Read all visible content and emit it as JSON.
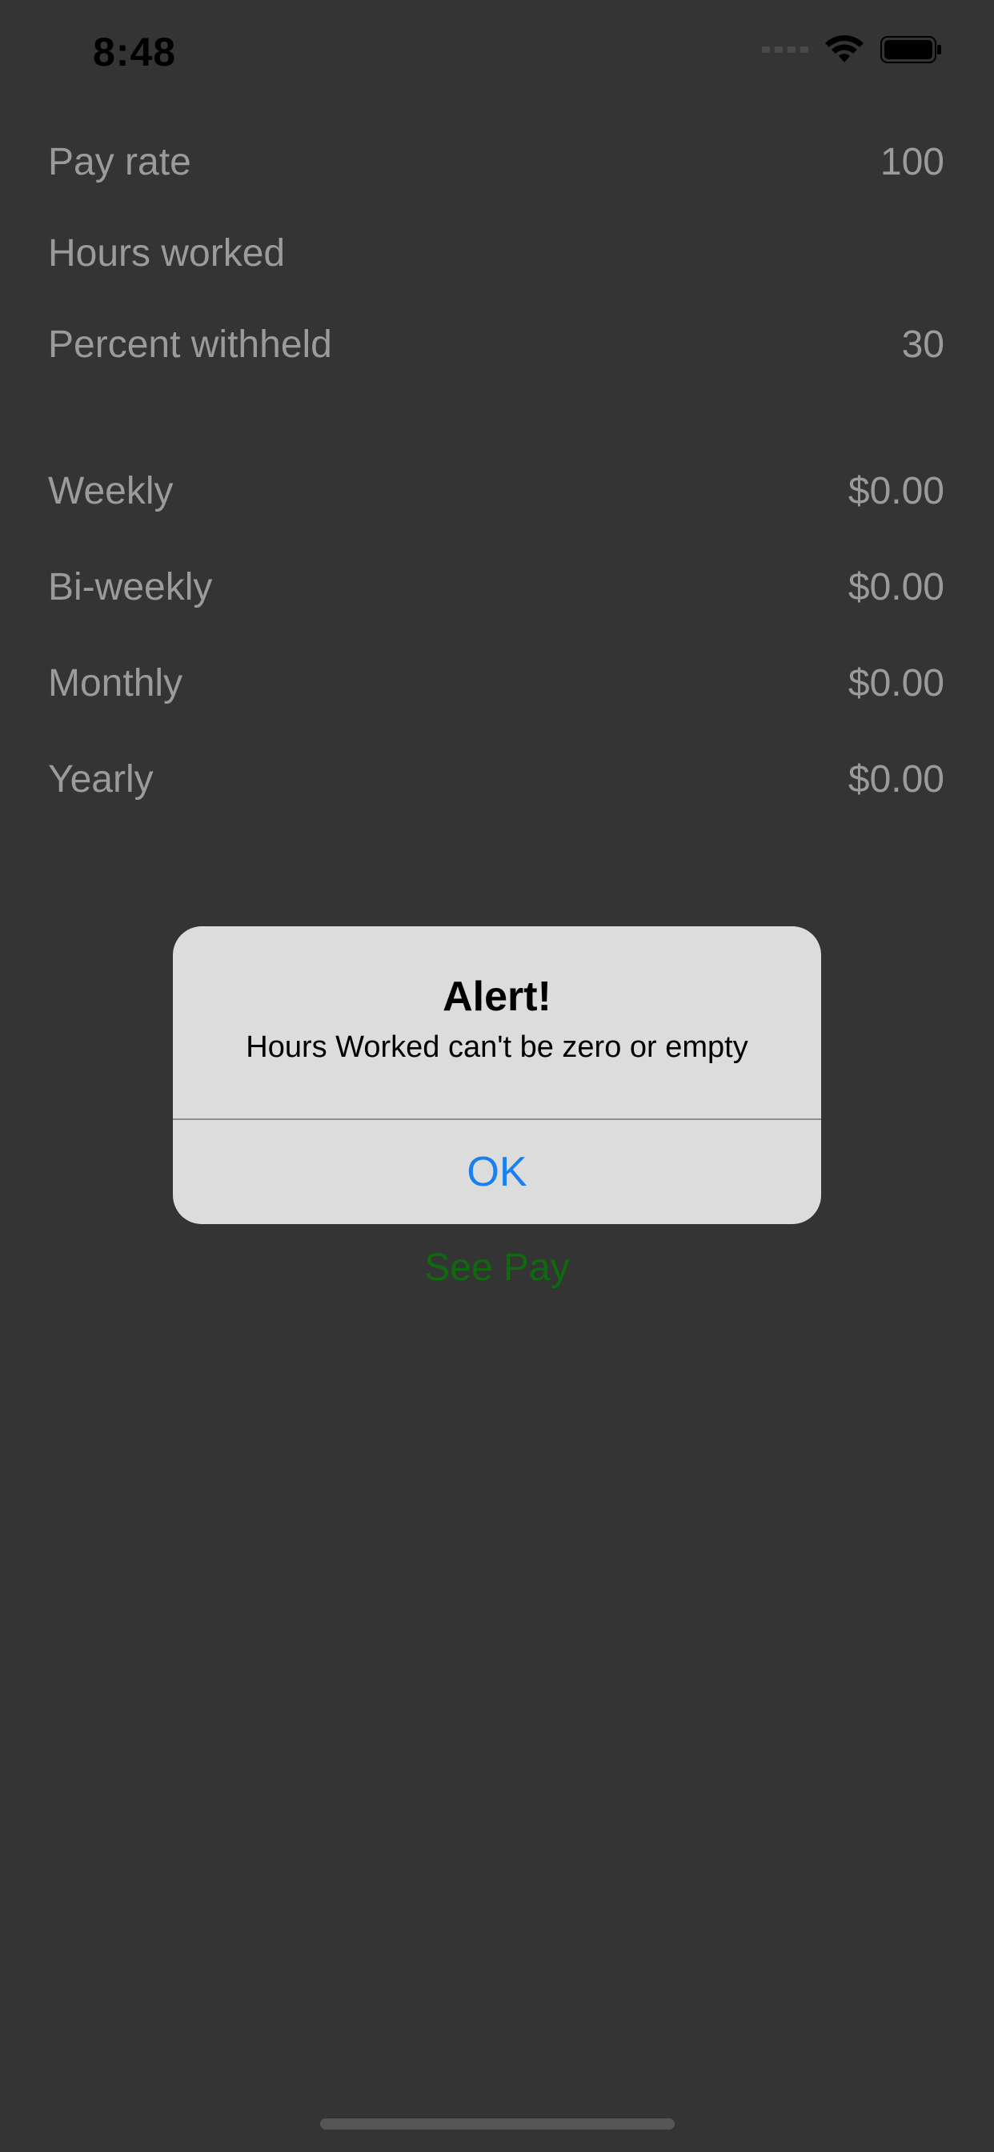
{
  "status_bar": {
    "time": "8:48",
    "icons": [
      "cellular-signal-icon",
      "wifi-icon",
      "battery-icon"
    ]
  },
  "inputs": {
    "pay_rate": {
      "label": "Pay rate",
      "value": "100"
    },
    "hours_worked": {
      "label": "Hours worked",
      "value": ""
    },
    "percent_withheld": {
      "label": "Percent withheld",
      "value": "30"
    }
  },
  "results": {
    "weekly": {
      "label": "Weekly",
      "value": "$0.00"
    },
    "biweekly": {
      "label": "Bi-weekly",
      "value": "$0.00"
    },
    "monthly": {
      "label": "Monthly",
      "value": "$0.00"
    },
    "yearly": {
      "label": "Yearly",
      "value": "$0.00"
    }
  },
  "see_pay_label": "See Pay",
  "alert": {
    "title": "Alert!",
    "message": "Hours Worked can't be zero or empty",
    "ok_label": "OK"
  },
  "colors": {
    "background": "#343434",
    "label_text": "#9b9b9b",
    "see_pay": "#0e6a0e",
    "alert_bg": "#dcdcdc",
    "alert_button": "#1a7ff0"
  }
}
